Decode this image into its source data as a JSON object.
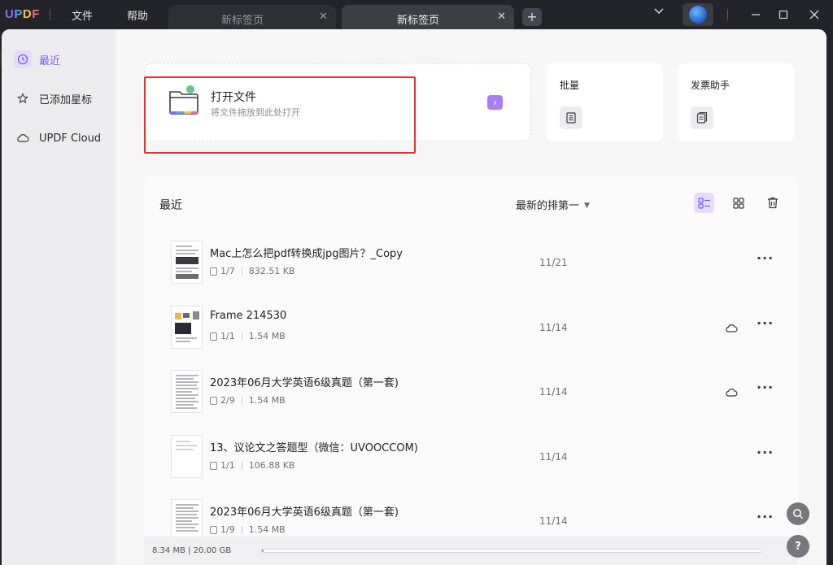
{
  "app": {
    "logo": {
      "u": "U",
      "p": "P",
      "d": "D",
      "f": "F"
    },
    "menu": [
      "文件",
      "帮助"
    ],
    "tabs": [
      {
        "label": "新标签页",
        "active": false
      },
      {
        "label": "新标签页",
        "active": true
      }
    ],
    "new_tab": "+",
    "window_controls": {
      "dropdown": "⌄",
      "minimize": "—",
      "maximize": "☐",
      "close": "✕"
    }
  },
  "sidebar": {
    "items": [
      {
        "label": "最近",
        "icon": "clock-icon",
        "active": true
      },
      {
        "label": "已添加星标",
        "icon": "star-icon",
        "active": false
      },
      {
        "label": "UPDF Cloud",
        "icon": "cloud-icon",
        "active": false
      }
    ]
  },
  "open_file": {
    "title": "打开文件",
    "subtitle": "将文件拖放到此处打开",
    "arrow": "›"
  },
  "tools": [
    {
      "title": "批量",
      "icon": "batch-icon"
    },
    {
      "title": "发票助手",
      "icon": "invoice-icon"
    }
  ],
  "recent": {
    "title": "最近",
    "sort_label": "最新的排第一",
    "files": [
      {
        "name": "Mac上怎么把pdf转换成jpg图片？_Copy",
        "pages": "1/7",
        "size": "832.51 KB",
        "date": "11/21",
        "cloud": false
      },
      {
        "name": "Frame 214530",
        "pages": "1/1",
        "size": "1.54 MB",
        "date": "11/14",
        "cloud": true
      },
      {
        "name": "2023年06月大学英语6级真题（第一套)",
        "pages": "2/9",
        "size": "1.54 MB",
        "date": "11/14",
        "cloud": true
      },
      {
        "name": "13、议论文之答题型（微信：UVOOCCOM)",
        "pages": "1/1",
        "size": "106.88 KB",
        "date": "11/14",
        "cloud": false
      },
      {
        "name": "2023年06月大学英语6级真题（第一套)",
        "pages": "1/9",
        "size": "1.54 MB",
        "date": "11/14",
        "cloud": false
      }
    ]
  },
  "storage": {
    "text": "8.34 MB | 20.00 GB",
    "used_fraction": 0.0004
  },
  "floating": {
    "search": "search-icon",
    "help": "?"
  },
  "colors": {
    "accent": "#a97ef7",
    "highlight": "#e03232",
    "titlebar": "#23232a"
  }
}
